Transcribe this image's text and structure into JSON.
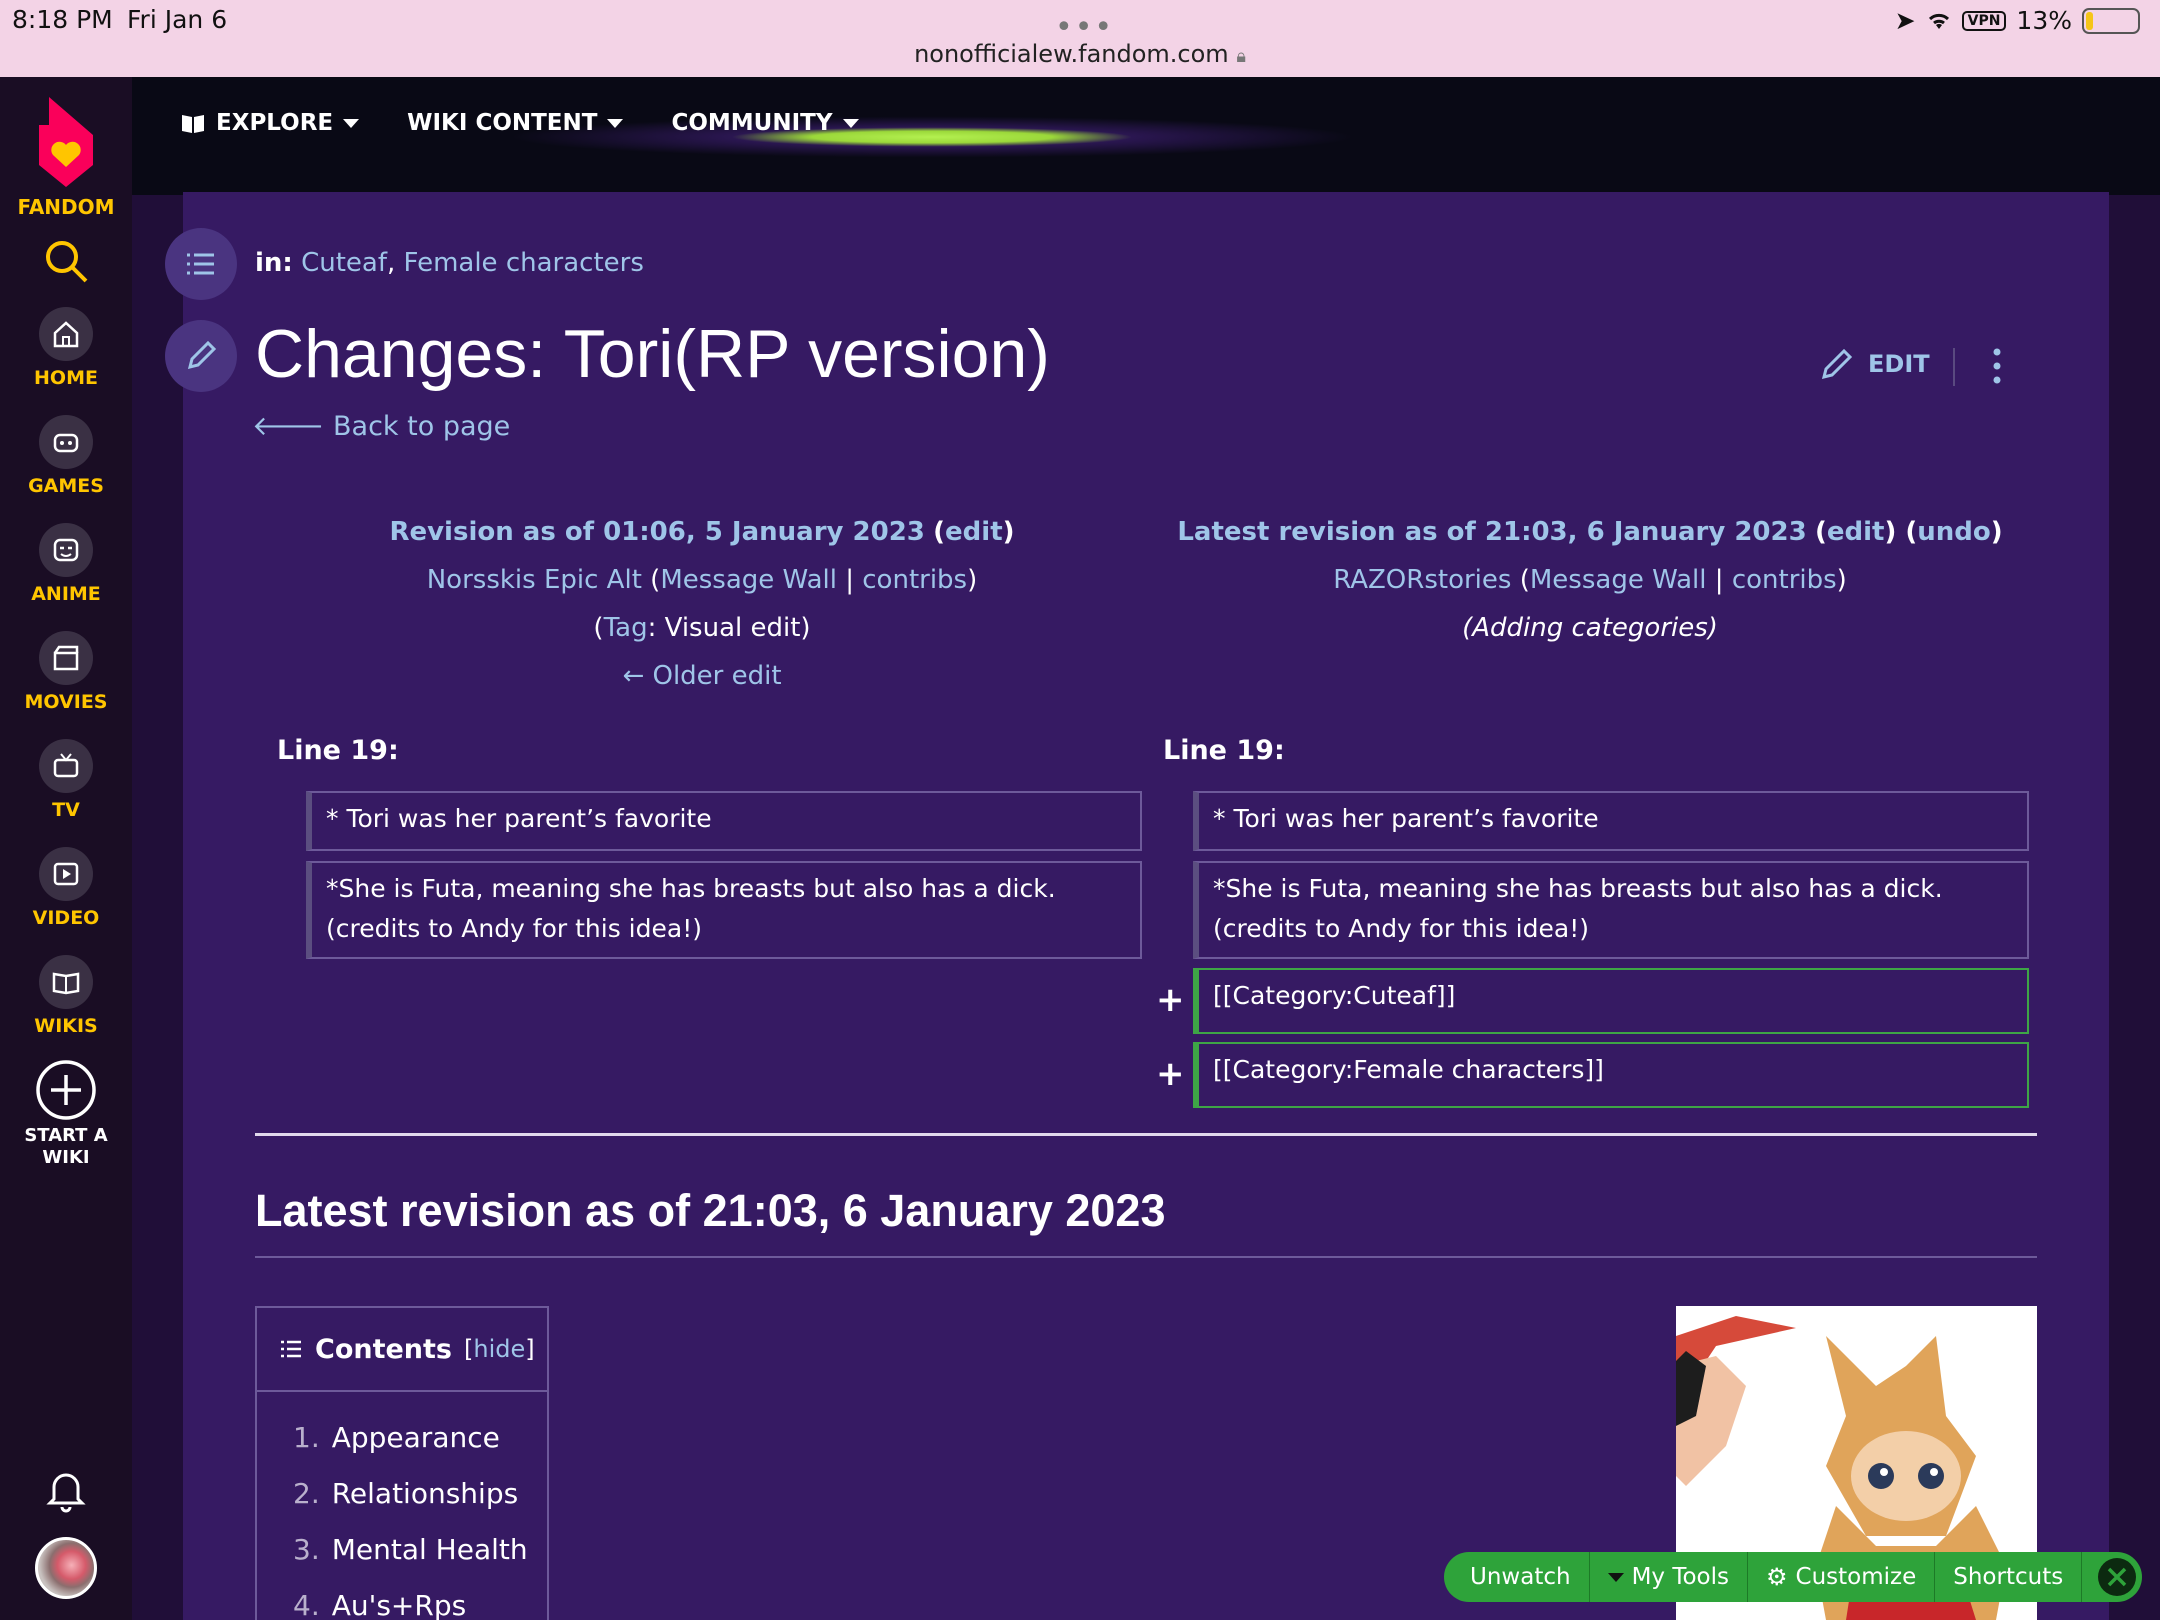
{
  "statusbar": {
    "time": "8:18 PM",
    "date": "Fri Jan 6",
    "url": "nonofficialew.fandom.com",
    "battery": "13%",
    "vpn": "VPN"
  },
  "sidebar": {
    "logo_label": "FANDOM",
    "items": [
      {
        "label": "HOME",
        "icon": "home-icon"
      },
      {
        "label": "GAMES",
        "icon": "gamepad-icon"
      },
      {
        "label": "ANIME",
        "icon": "anime-icon"
      },
      {
        "label": "MOVIES",
        "icon": "clapper-icon"
      },
      {
        "label": "TV",
        "icon": "tv-icon"
      },
      {
        "label": "VIDEO",
        "icon": "video-icon"
      },
      {
        "label": "WIKIS",
        "icon": "book-icon"
      }
    ],
    "start_wiki": "START A WIKI"
  },
  "topnav": {
    "explore": "EXPLORE",
    "wiki_content": "WIKI CONTENT",
    "community": "COMMUNITY"
  },
  "page": {
    "categories_label": "in:",
    "categories": [
      "Cuteaf",
      "Female characters"
    ],
    "title": "Changes: Tori(RP version)",
    "back": "Back to page",
    "edit": "EDIT"
  },
  "revision_left": {
    "heading": "Revision as of 01:06, 5 January 2023",
    "edit": "edit",
    "user": "Norsskis Epic Alt",
    "message_wall": "Message Wall",
    "contribs": "contribs",
    "tag_label": "Tag",
    "tag_value": ": Visual edit",
    "older": "← Older edit"
  },
  "revision_right": {
    "heading": "Latest revision as of 21:03, 6 January 2023",
    "edit": "edit",
    "undo": "undo",
    "user": "RAZORstories",
    "message_wall": "Message Wall",
    "contribs": "contribs",
    "summary": "(Adding categories)"
  },
  "diff": {
    "left_label": "Line 19:",
    "right_label": "Line 19:",
    "line1": "* Tori was her parent’s favorite",
    "line2a": "*She is Futa, meaning she has breasts but also has a dick.",
    "line2b": "(credits to Andy for this idea!)",
    "added1": "[[Category:Cuteaf]]",
    "added2": "[[Category:Female characters]]",
    "plus": "+"
  },
  "latest": {
    "heading": "Latest revision as of 21:03, 6 January 2023"
  },
  "toc": {
    "title": "Contents",
    "hide": "hide",
    "items": [
      {
        "num": "1.",
        "label": "Appearance"
      },
      {
        "num": "2.",
        "label": "Relationships"
      },
      {
        "num": "3.",
        "label": "Mental Health"
      },
      {
        "num": "4.",
        "label": "Au's+Rps"
      }
    ]
  },
  "toolbar": {
    "unwatch": "Unwatch",
    "my_tools": "My Tools",
    "customize": "Customize",
    "shortcuts": "Shortcuts"
  }
}
